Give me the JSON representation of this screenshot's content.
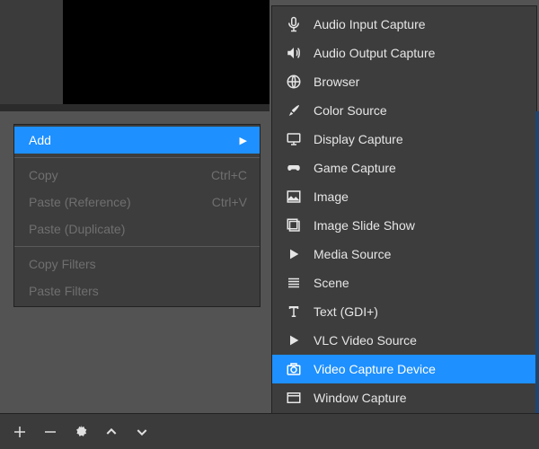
{
  "context_menu": {
    "add": "Add",
    "copy": "Copy",
    "copy_shortcut": "Ctrl+C",
    "paste_ref": "Paste (Reference)",
    "paste_ref_shortcut": "Ctrl+V",
    "paste_dup": "Paste (Duplicate)",
    "copy_filters": "Copy Filters",
    "paste_filters": "Paste Filters"
  },
  "submenu": {
    "items": [
      {
        "label": "Audio Input Capture",
        "icon": "microphone-icon"
      },
      {
        "label": "Audio Output Capture",
        "icon": "speaker-icon"
      },
      {
        "label": "Browser",
        "icon": "globe-icon"
      },
      {
        "label": "Color Source",
        "icon": "brush-icon"
      },
      {
        "label": "Display Capture",
        "icon": "monitor-icon"
      },
      {
        "label": "Game Capture",
        "icon": "gamepad-icon"
      },
      {
        "label": "Image",
        "icon": "image-icon"
      },
      {
        "label": "Image Slide Show",
        "icon": "slides-icon"
      },
      {
        "label": "Media Source",
        "icon": "play-icon"
      },
      {
        "label": "Scene",
        "icon": "list-icon"
      },
      {
        "label": "Text (GDI+)",
        "icon": "text-icon"
      },
      {
        "label": "VLC Video Source",
        "icon": "play-icon"
      },
      {
        "label": "Video Capture Device",
        "icon": "camera-icon",
        "selected": true
      },
      {
        "label": "Window Capture",
        "icon": "window-icon"
      }
    ]
  }
}
